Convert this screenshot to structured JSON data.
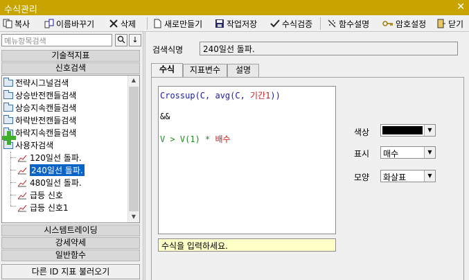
{
  "window": {
    "title": "수식관리",
    "close_glyph": "✕"
  },
  "toolbar": {
    "copy": "복사",
    "rename": "이름바꾸기",
    "delete": "삭제",
    "new": "새로만들기",
    "save": "작업저장",
    "verify": "수식검증",
    "func_help": "함수설명",
    "password": "암호설정",
    "close": "닫기"
  },
  "left": {
    "search_placeholder": "메뉴항목검색",
    "search_btn": "🔍",
    "down_btn": "↓",
    "categories_top": [
      "기술적지표",
      "신호검색"
    ],
    "tree": {
      "folders": [
        "전략시그널검색",
        "상승반전캔들검색",
        "상승지속캔들검색",
        "하락반전캔들검색",
        "하락지속캔들검색",
        "사용자검색"
      ],
      "items": [
        "120일선 돌파.",
        "240일선 돌파.",
        "480일선 돌파.",
        "급등 신호",
        "급등 신호1"
      ],
      "selected_item": "240일선 돌파."
    },
    "categories_bottom": [
      "시스템트레이딩",
      "강세약세",
      "일반함수"
    ],
    "load_button": "다른 ID 지표 불러오기"
  },
  "right": {
    "name_label": "검색식명",
    "name_value": "240일선 돌파.",
    "tabs": [
      "수식",
      "지표변수",
      "설명"
    ],
    "active_tab": "수식",
    "formula": {
      "line1": {
        "fn": "Crossup(C, avg(C, ",
        "param": "기간1",
        "tail": "))"
      },
      "line2": "&&",
      "line3": {
        "expr": "V > V(1) * ",
        "param": "배수"
      }
    },
    "hint": "수식을 입력하세요.",
    "props": {
      "color_label": "색상",
      "color_value": "#000000",
      "display_label": "표시",
      "display_value": "매수",
      "shape_label": "모양",
      "shape_value": "화살표"
    }
  },
  "colors": {
    "titlebar": "#c8a400",
    "selection": "#0a64c8",
    "formula_blue": "#1a1aa6",
    "formula_red": "#c81e1e",
    "formula_green": "#1e8c1e",
    "hint_bg": "#ffffc8"
  }
}
